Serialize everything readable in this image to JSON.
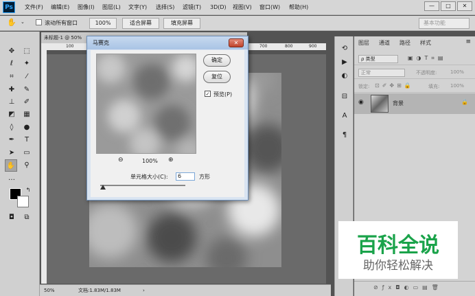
{
  "app": {
    "logo": "Ps"
  },
  "menu": [
    "文件(F)",
    "编辑(E)",
    "图像(I)",
    "图层(L)",
    "文字(Y)",
    "选择(S)",
    "滤镜(T)",
    "3D(D)",
    "视图(V)",
    "窗口(W)",
    "帮助(H)"
  ],
  "window_controls": {
    "minimize": "—",
    "maximize": "□",
    "close": "✕"
  },
  "options": {
    "scroll_all_label": "滚动所有窗口",
    "zoom_value": "100%",
    "fit_screen": "适合屏幕",
    "fill_screen": "填充屏幕",
    "workspace": "基本功能"
  },
  "document": {
    "tab_title": "未标题-1 @ 50%",
    "ruler_ticks": [
      "100",
      "700",
      "800",
      "900"
    ],
    "zoom": "50%",
    "doc_info": "文档:1.83M/1.83M"
  },
  "dialog": {
    "title": "马赛克",
    "close_glyph": "✕",
    "ok": "确定",
    "reset": "复位",
    "preview_label": "预览(P)",
    "preview_checked": true,
    "zoom_value": "100%",
    "cell_size_label": "单元格大小(C):",
    "cell_size_value": "6",
    "unit": "方形"
  },
  "layers_panel": {
    "tabs": [
      "图层",
      "通道",
      "路径",
      "样式"
    ],
    "filter_kind": "ρ 类型",
    "blend_mode": "正常",
    "opacity_label": "不透明度:",
    "opacity_value": "100%",
    "lock_label": "锁定:",
    "fill_label": "填充:",
    "fill_value": "100%",
    "layer_name": "背景"
  },
  "watermark": {
    "line1": "百科全说",
    "line2": "助你轻松解决"
  },
  "colors": {
    "watermark_green": "#1aa34a",
    "dialog_title": "#a9c4e5",
    "close_red": "#c0432b"
  }
}
